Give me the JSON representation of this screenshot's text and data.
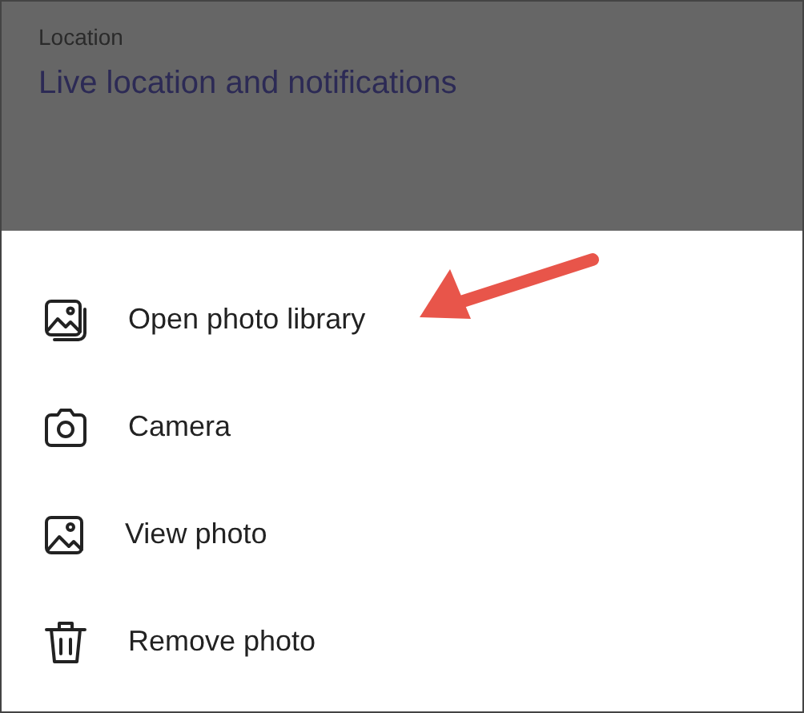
{
  "background": {
    "label": "Location",
    "value": "Live location and notifications"
  },
  "sheet": {
    "items": [
      {
        "kind": "gallery",
        "label": "Open photo library",
        "highlighted": true
      },
      {
        "kind": "camera",
        "label": "Camera",
        "highlighted": false
      },
      {
        "kind": "image",
        "label": "View photo",
        "highlighted": false
      },
      {
        "kind": "trash",
        "label": "Remove photo",
        "highlighted": false
      }
    ]
  }
}
